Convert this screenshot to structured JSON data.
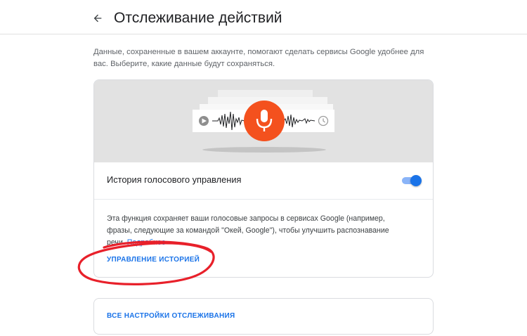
{
  "header": {
    "title": "Отслеживание действий",
    "back_icon": "arrow-back-icon"
  },
  "intro_text": "Данные, сохраненные в вашем аккаунте, помогают сделать сервисы Google удобнее для вас. Выберите, какие данные будут сохраняться.",
  "voice_card": {
    "illustration": {
      "icons": [
        "play-icon",
        "microphone-icon",
        "clock-icon"
      ],
      "mic_color": "#f4511e"
    },
    "setting_label": "История голосового управления",
    "toggle_on": true,
    "description": "Эта функция сохраняет ваши голосовые запросы в сервисах Google (например, фразы, следующие за командой \"Окей, Google\"), чтобы улучшить распознавание речи.",
    "learn_more": "Подробнее",
    "manage_link": "УПРАВЛЕНИЕ ИСТОРИЕЙ"
  },
  "all_settings_link": "ВСЕ НАСТРОЙКИ ОТСЛЕЖИВАНИЯ",
  "colors": {
    "accent": "#1a73e8",
    "annotation": "#e8202a"
  }
}
